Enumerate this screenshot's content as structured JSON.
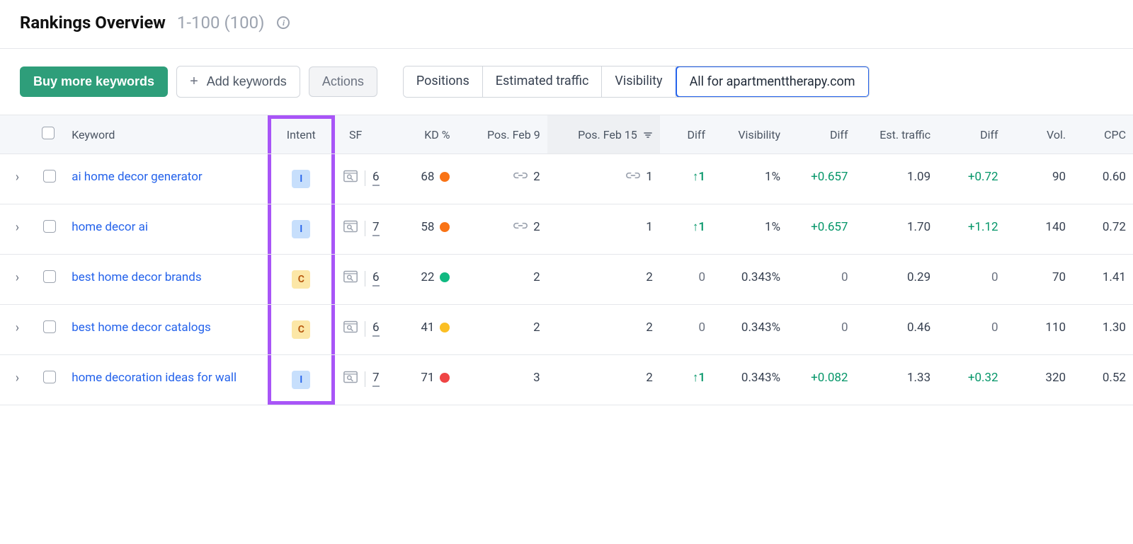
{
  "header": {
    "title": "Rankings Overview",
    "range": "1-100 (100)"
  },
  "toolbar": {
    "buy_label": "Buy more keywords",
    "add_label": "Add keywords",
    "actions_label": "Actions"
  },
  "tabs": [
    {
      "label": "Positions"
    },
    {
      "label": "Estimated traffic"
    },
    {
      "label": "Visibility"
    },
    {
      "label": "All for apartmenttherapy.com",
      "active": true
    }
  ],
  "columns": {
    "keyword": "Keyword",
    "intent": "Intent",
    "sf": "SF",
    "kd": "KD %",
    "pos1": "Pos. Feb 9",
    "pos2": "Pos. Feb 15",
    "diff1": "Diff",
    "visibility": "Visibility",
    "diff2": "Diff",
    "est": "Est. traffic",
    "diff3": "Diff",
    "vol": "Vol.",
    "cpc": "CPC"
  },
  "rows": [
    {
      "keyword": "ai home decor generator",
      "intent": "I",
      "sf": "6",
      "kd": "68",
      "kd_color": "orange",
      "pos1": "2",
      "pos1_link": true,
      "pos2": "1",
      "pos2_link": true,
      "diff1": "↑1",
      "diff1_class": "diff-up",
      "visibility": "1%",
      "diff2": "+0.657",
      "diff2_class": "diff-pos",
      "est": "1.09",
      "diff3": "+0.72",
      "diff3_class": "diff-pos",
      "vol": "90",
      "cpc": "0.60"
    },
    {
      "keyword": "home decor ai",
      "intent": "I",
      "sf": "7",
      "kd": "58",
      "kd_color": "orange",
      "pos1": "2",
      "pos1_link": true,
      "pos2": "1",
      "pos2_link": false,
      "diff1": "↑1",
      "diff1_class": "diff-up",
      "visibility": "1%",
      "diff2": "+0.657",
      "diff2_class": "diff-pos",
      "est": "1.70",
      "diff3": "+1.12",
      "diff3_class": "diff-pos",
      "vol": "140",
      "cpc": "0.72"
    },
    {
      "keyword": "best home decor brands",
      "intent": "C",
      "sf": "6",
      "kd": "22",
      "kd_color": "green",
      "pos1": "2",
      "pos1_link": false,
      "pos2": "2",
      "pos2_link": false,
      "diff1": "0",
      "diff1_class": "diff-zero",
      "visibility": "0.343%",
      "diff2": "0",
      "diff2_class": "diff-zero",
      "est": "0.29",
      "diff3": "0",
      "diff3_class": "diff-zero",
      "vol": "70",
      "cpc": "1.41"
    },
    {
      "keyword": "best home decor catalogs",
      "intent": "C",
      "sf": "6",
      "kd": "41",
      "kd_color": "yellow",
      "pos1": "2",
      "pos1_link": false,
      "pos2": "2",
      "pos2_link": false,
      "diff1": "0",
      "diff1_class": "diff-zero",
      "visibility": "0.343%",
      "diff2": "0",
      "diff2_class": "diff-zero",
      "est": "0.46",
      "diff3": "0",
      "diff3_class": "diff-zero",
      "vol": "110",
      "cpc": "1.30"
    },
    {
      "keyword": "home decoration ideas for wall",
      "intent": "I",
      "sf": "7",
      "kd": "71",
      "kd_color": "red",
      "pos1": "3",
      "pos1_link": false,
      "pos2": "2",
      "pos2_link": false,
      "diff1": "↑1",
      "diff1_class": "diff-up",
      "visibility": "0.343%",
      "diff2": "+0.082",
      "diff2_class": "diff-pos",
      "est": "1.33",
      "diff3": "+0.32",
      "diff3_class": "diff-pos",
      "vol": "320",
      "cpc": "0.52"
    }
  ]
}
